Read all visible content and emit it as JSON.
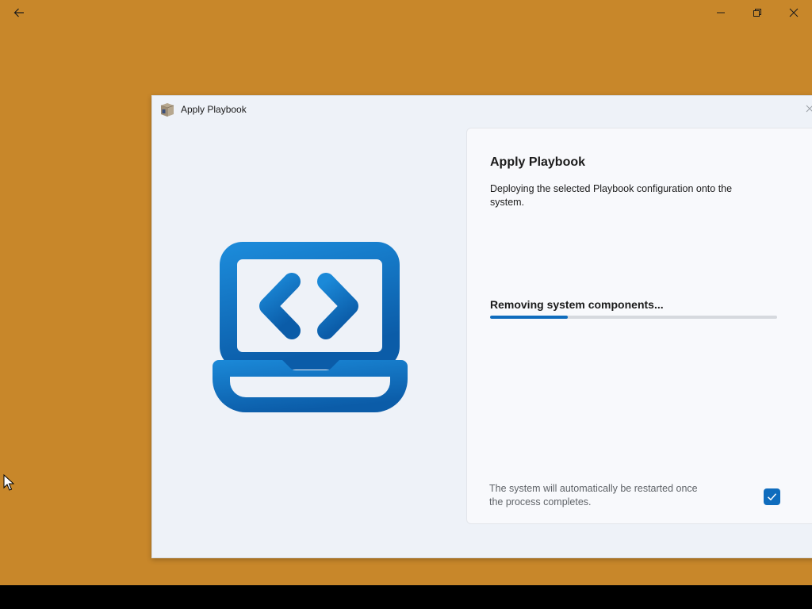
{
  "window": {
    "back_icon": "arrow-left-icon",
    "controls": [
      "minimize-icon",
      "restore-icon",
      "close-icon"
    ]
  },
  "dialog": {
    "title": "Apply Playbook",
    "app_icon": "package-box-icon",
    "close_icon": "close-icon",
    "illustration_icon": "laptop-code-icon",
    "card": {
      "heading": "Apply Playbook",
      "description": "Deploying the selected Playbook configuration onto the system.",
      "status": "Removing system components...",
      "progress_percent": 27,
      "restart_note": "The system will automatically be restarted once the process completes.",
      "restart_checked": true
    }
  },
  "colors": {
    "desktop": "#C8872A",
    "accent": "#0F6CBD",
    "taskbar": "#000000"
  }
}
